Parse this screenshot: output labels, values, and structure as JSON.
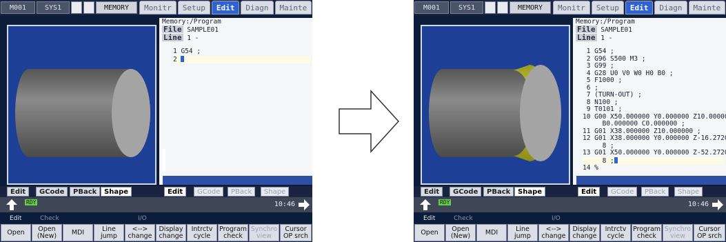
{
  "top": {
    "mode": "M001",
    "sys": "SYS1",
    "memory": "MEMORY",
    "tabs": [
      "Monitr",
      "Setup",
      "Edit",
      "Diagn",
      "Mainte"
    ]
  },
  "program": {
    "path": "Memory:/Program",
    "file_label": "File",
    "file_name": "SAMPLE01",
    "line_label": "Line",
    "line_value": "1 -"
  },
  "before_lines": [
    "1 G54 ;",
    "2 "
  ],
  "after_lines": [
    " 1 G54 ;",
    " 2 G96 S500 M3 ;",
    " 3 G99 ;",
    " 4 G28 U0 V0 W0 H0 B0 ;",
    " 5 F1000 ;",
    " 6 ;",
    " 7 (TURN-OUT) ;",
    " 8 N100 ;",
    " 9 T0101 ;",
    "10 G00 X50.000000 Y0.000000 Z10.000000",
    "     B0.000000 C0.000000 ;",
    "11 G01 X38.000000 Z10.000000 ;",
    "12 G01 X38.000000 Y0.000000 Z-16.27207",
    "     8 ;",
    "13 G01 X50.000000 Y0.000000 Z-52.27207",
    "     8 ;",
    "14 %"
  ],
  "graphic_tabs": [
    "Edit",
    "GCode",
    "PBack",
    "Shape"
  ],
  "status": {
    "ready": "RDY",
    "time": "10:46"
  },
  "softkey_labels": [
    "Edit",
    "Check",
    "I/O"
  ],
  "softkeys": [
    "Open",
    "Open\n(New)",
    "MDI",
    "Line\njump",
    "<-->\nchange",
    "Display\nchange",
    "Intrctv\ncycle",
    "Program\ncheck",
    "Synchro\nview",
    "Cursor\nOP srch"
  ],
  "colors": {
    "accent": "#2f62d4",
    "workpiece_cut": "#c7c73a",
    "ready": "#66d04a"
  }
}
